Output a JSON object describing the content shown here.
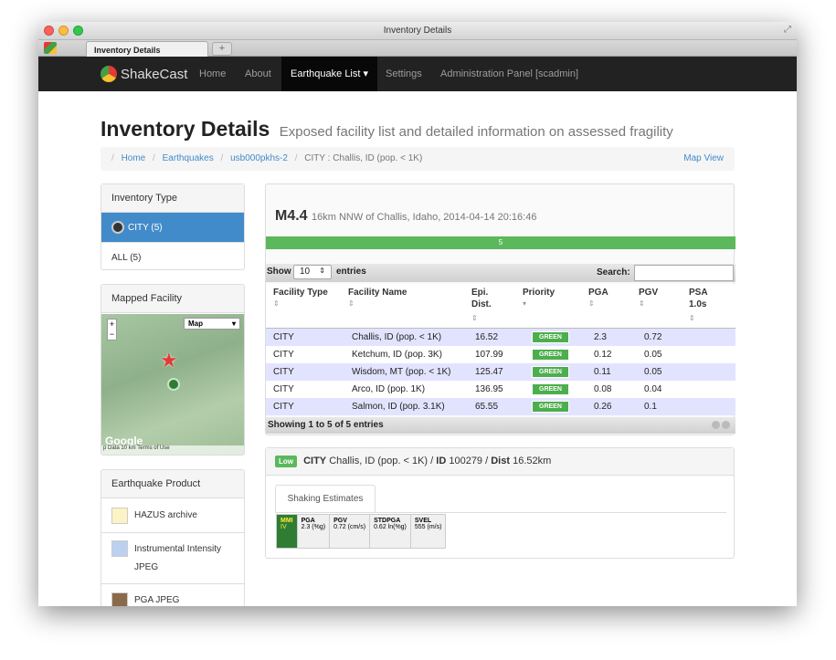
{
  "window": {
    "title": "Inventory Details"
  },
  "tab": {
    "label": "Inventory Details",
    "new_tab": "+"
  },
  "navbar": {
    "brand": "ShakeCast",
    "items": [
      "Home",
      "About",
      "Earthquake List ▾",
      "Settings",
      "Administration Panel [scadmin]"
    ]
  },
  "page": {
    "title": "Inventory Details",
    "subtitle": "Exposed facility list and detailed information on assessed fragility"
  },
  "breadcrumb": {
    "items": [
      "Home",
      "Earthquakes",
      "usb000pkhs-2"
    ],
    "current": "CITY : Challis, ID (pop. < 1K)",
    "map_view": "Map View"
  },
  "inventory_type": {
    "heading": "Inventory Type",
    "items": [
      "CITY (5)",
      "ALL (5)"
    ]
  },
  "mapped_facility": {
    "heading": "Mapped Facility",
    "map_type": "Map",
    "zoom_in": "+",
    "zoom_out": "−",
    "google": "Google",
    "attribution": "p Data  10 km          Terms of Use"
  },
  "earthquake_product": {
    "heading": "Earthquake Product",
    "items": [
      "HAZUS archive",
      "Instrumental Intensity JPEG",
      "PGA JPEG"
    ]
  },
  "event": {
    "magnitude": "M4.4",
    "description": "16km NNW of Challis, Idaho, 2014-04-14 20:16:46",
    "progress_label": "5"
  },
  "table": {
    "show_label": "Show",
    "show_value": "10",
    "entries_label": "entries",
    "search_label": "Search:",
    "headers": [
      "Facility Type",
      "Facility Name",
      "Epi. Dist.",
      "Priority",
      "PGA",
      "PGV",
      "PSA 1.0s"
    ],
    "rows": [
      [
        "CITY",
        "Challis, ID (pop. < 1K)",
        "16.52",
        "GREEN",
        "2.3",
        "0.72",
        ""
      ],
      [
        "CITY",
        "Ketchum, ID (pop. 3K)",
        "107.99",
        "GREEN",
        "0.12",
        "0.05",
        ""
      ],
      [
        "CITY",
        "Wisdom, MT (pop. < 1K)",
        "125.47",
        "GREEN",
        "0.11",
        "0.05",
        ""
      ],
      [
        "CITY",
        "Arco, ID (pop. 1K)",
        "136.95",
        "GREEN",
        "0.08",
        "0.04",
        ""
      ],
      [
        "CITY",
        "Salmon, ID (pop. 3.1K)",
        "65.55",
        "GREEN",
        "0.26",
        "0.1",
        ""
      ]
    ],
    "footer": "Showing 1 to 5 of 5 entries"
  },
  "detail": {
    "badge": "Low",
    "type": "CITY",
    "name": "Challis, ID (pop. < 1K) /",
    "id_label": "ID",
    "id_value": "100279 /",
    "dist_label": "Dist",
    "dist_value": "16.52km",
    "tab": "Shaking Estimates",
    "shaking": [
      {
        "label": "MMI",
        "value": "IV"
      },
      {
        "label": "PGA",
        "value": "2.3 (%g)"
      },
      {
        "label": "PGV",
        "value": "0.72 (cm/s)"
      },
      {
        "label": "STDPGA",
        "value": "0.62 ln(%g)"
      },
      {
        "label": "SVEL",
        "value": "555 (m/s)"
      }
    ]
  },
  "colors": {
    "primary": "#428bca",
    "success": "#5cb85c",
    "navbar": "#222222"
  }
}
